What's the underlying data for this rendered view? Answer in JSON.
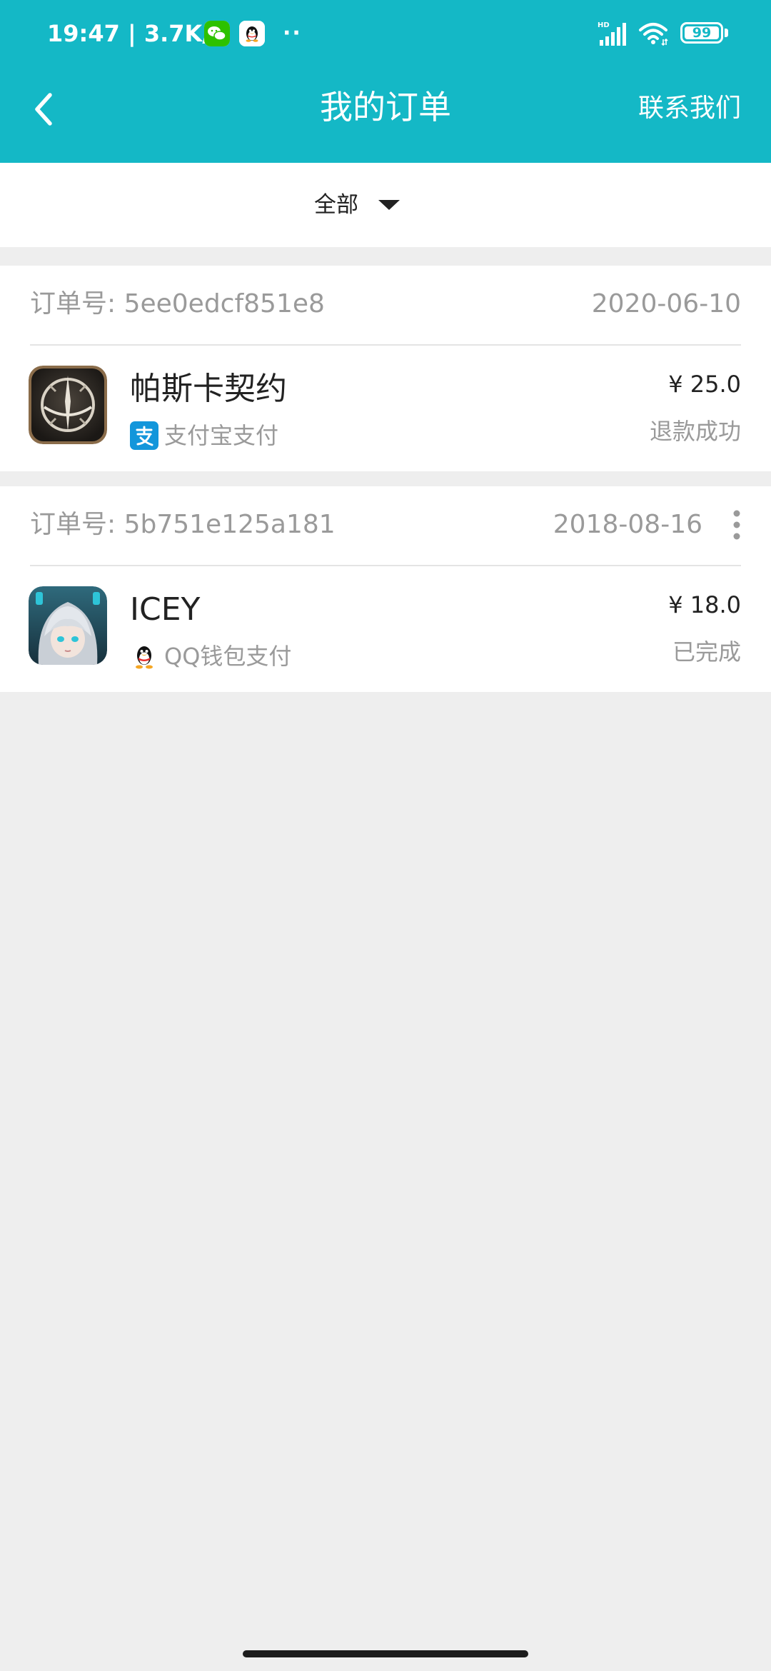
{
  "status_bar": {
    "time": "19:47 | 3.7K/s",
    "dots": "··",
    "signal_badge": "HD",
    "battery": "99"
  },
  "app_bar": {
    "title": "我的订单",
    "contact_label": "联系我们"
  },
  "filter": {
    "selected": "全部"
  },
  "orders": [
    {
      "order_id": "订单号: 5ee0edcf851e8",
      "date": "2020-06-10",
      "title": "帕斯卡契约",
      "payment": "支付宝支付",
      "price": "¥ 25.0",
      "status": "退款成功"
    },
    {
      "order_id": "订单号: 5b751e125a181",
      "date": "2018-08-16",
      "title": "ICEY",
      "payment": "QQ钱包支付",
      "price": "¥ 18.0",
      "status": "已完成"
    }
  ],
  "icons": {
    "back": "chevron-left-icon",
    "dropdown": "triangle-down-icon",
    "more": "vertical-dots-icon",
    "alipay": "alipay-icon",
    "qq_wallet": "qq-penguin-icon"
  },
  "colors": {
    "header": "#14b8c6",
    "page_background": "#eeeeee",
    "card": "#ffffff",
    "primary_text": "#222222",
    "secondary_text": "#9a9a9a",
    "alipay_blue": "#1296db"
  }
}
